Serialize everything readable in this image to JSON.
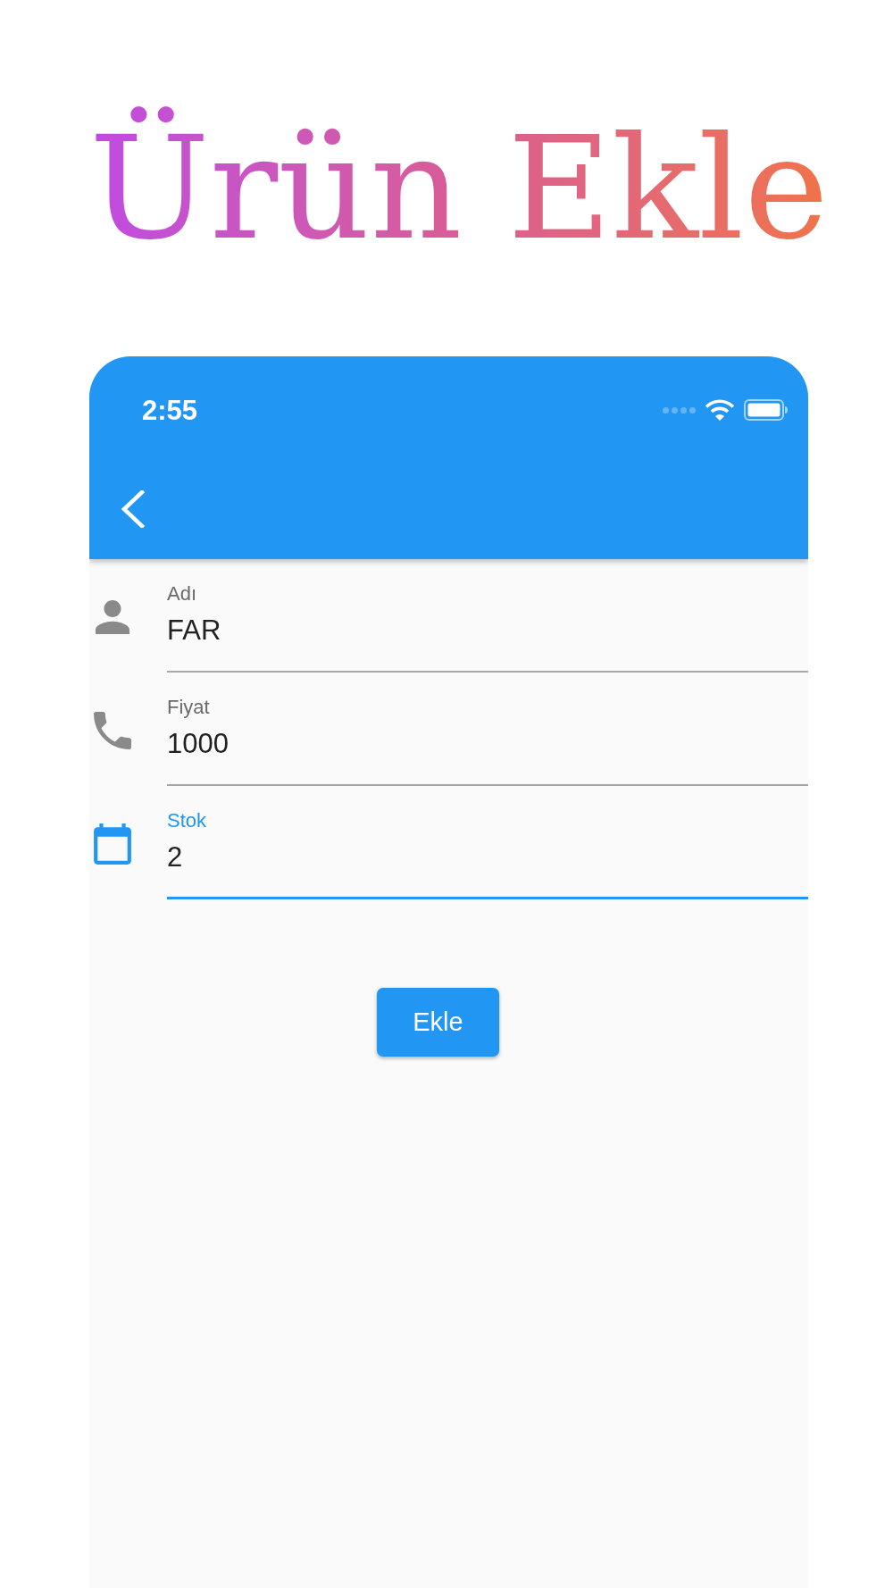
{
  "page_title": "Ürün Ekle",
  "status_bar": {
    "time": "2:55"
  },
  "form": {
    "fields": [
      {
        "label": "Adı",
        "value": "FAR",
        "focused": false
      },
      {
        "label": "Fiyat",
        "value": "1000",
        "focused": false
      },
      {
        "label": "Stok",
        "value": "2",
        "focused": true
      }
    ]
  },
  "submit_button": {
    "label": "Ekle"
  }
}
